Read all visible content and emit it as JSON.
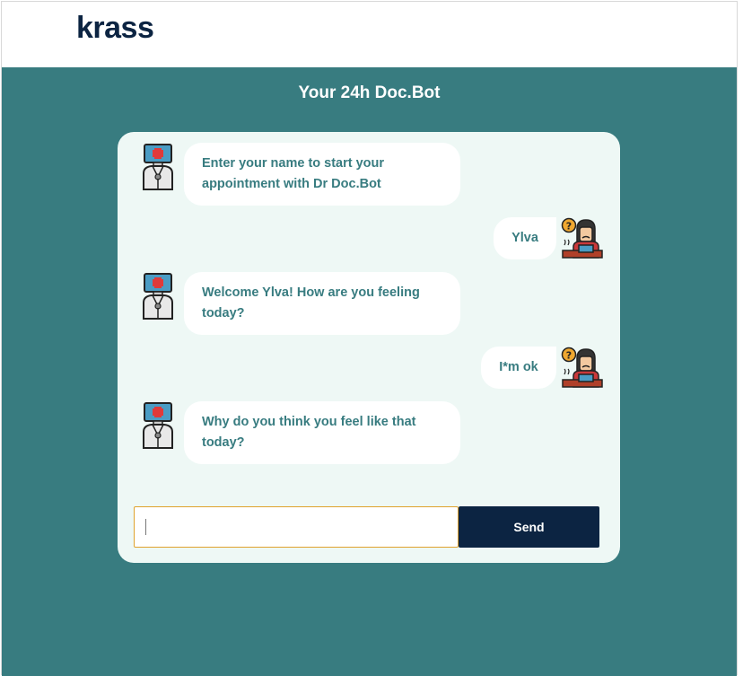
{
  "header": {
    "logo_text": "krass"
  },
  "page": {
    "title": "Your 24h Doc.Bot"
  },
  "chat": {
    "messages": [
      {
        "sender": "bot",
        "text": "Enter your name to start your appointment with Dr Doc.Bot",
        "avatar_icon": "doctor-robot-icon"
      },
      {
        "sender": "user",
        "text": "Ylva",
        "avatar_icon": "confused-user-icon"
      },
      {
        "sender": "bot",
        "text": "Welcome Ylva! How are you feeling today?",
        "avatar_icon": "doctor-robot-icon"
      },
      {
        "sender": "user",
        "text": "I*m ok",
        "avatar_icon": "confused-user-icon"
      },
      {
        "sender": "bot",
        "text": "Why do you think you feel like that today?",
        "avatar_icon": "doctor-robot-icon"
      }
    ],
    "input": {
      "value": "",
      "placeholder": ""
    },
    "send_label": "Send"
  },
  "colors": {
    "brand_dark": "#0c2442",
    "teal": "#387c80",
    "card_bg": "#eef8f5",
    "input_border": "#e0a32e"
  }
}
